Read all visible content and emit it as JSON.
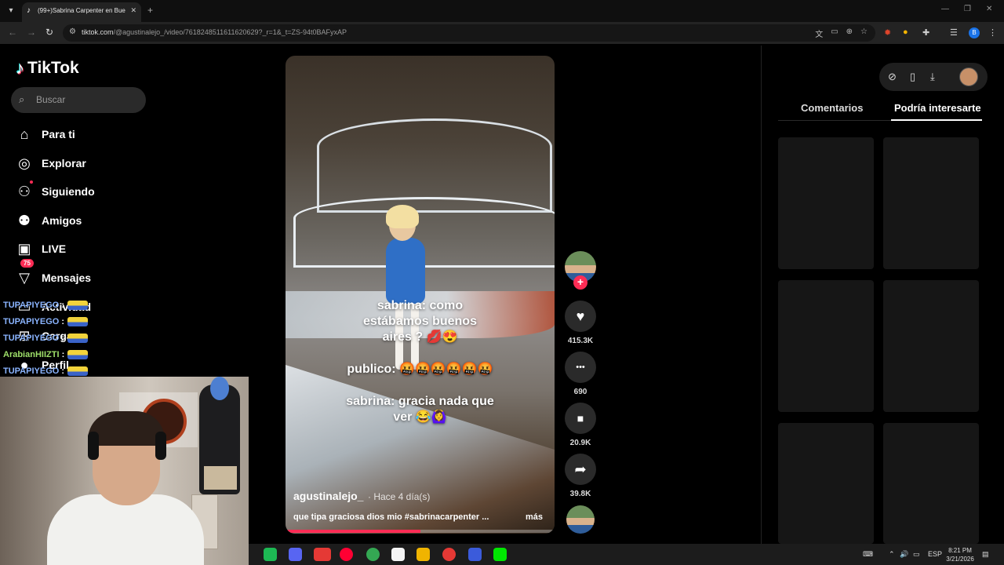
{
  "browser": {
    "tab_title": "(99+)Sabrina Carpenter en Bue...",
    "tab_favicon": "♪",
    "tab_close": "✕",
    "new_tab": "+",
    "url_host": "tiktok.com",
    "url_path": "/@agustinalejo_/video/7618248511611620629?_r=1&_t=ZS-94t0BAFyxAP",
    "back_icon": "←",
    "forward_icon": "→",
    "reload_icon": "↻",
    "profile_initial": "B"
  },
  "tiktok": {
    "logo_text": "TikTok",
    "logo_icon": "♪",
    "search_placeholder": "Buscar",
    "nav": [
      {
        "label": "Para ti",
        "icon": "⌂"
      },
      {
        "label": "Explorar",
        "icon": "◎"
      },
      {
        "label": "Siguiendo",
        "icon": "⚇"
      },
      {
        "label": "Amigos",
        "icon": "⚉"
      },
      {
        "label": "LIVE",
        "icon": "▣"
      },
      {
        "label": "Mensajes",
        "icon": "▽",
        "badge": "75"
      },
      {
        "label": "Actividad",
        "icon": "▭"
      },
      {
        "label": "Cargar",
        "icon": "⊞"
      },
      {
        "label": "Perfil",
        "icon": "●"
      }
    ]
  },
  "chat": [
    {
      "user": "TUPAPIYEGO",
      "sep": ":"
    },
    {
      "user": "TUPAPIYEGO",
      "sep": ":"
    },
    {
      "user": "TUPAPIYEGO",
      "sep": ":"
    },
    {
      "user": "ArabianHIIZTI",
      "sep": ":"
    },
    {
      "user": "TUPAPIYEGO",
      "sep": ":"
    }
  ],
  "video": {
    "caption1": "sabrina: como\nestábamos buenos\naires ? 💋😍",
    "caption2": "publico: 🤬🤬🤬🤬🤬🤬",
    "caption3": "sabrina: gracia nada que\nver 😂🙆‍♀️",
    "author": "agustinalejo_",
    "time": "· Hace 4 día(s)",
    "description": "que tipa graciosa dios mio #sabrinacarpenter ...",
    "more": "más",
    "progress": 0.5
  },
  "actions": {
    "follow": "+",
    "like_icon": "♥",
    "likes": "415.3K",
    "comment_icon": "•••",
    "comments": "690",
    "save_icon": "■",
    "saves": "20.9K",
    "share_icon": "➦",
    "shares": "39.8K"
  },
  "right_panel": {
    "tab_comments": "Comentarios",
    "tab_related": "Podría interesarte",
    "icons": [
      "⊘",
      "▯",
      "⤓"
    ]
  },
  "taskbar": {
    "lang": "ESP",
    "time": "8:21 PM",
    "date": "3/21/2026",
    "app_colors": [
      "#1db954",
      "#5865f2",
      "#e53935",
      "#ff0033",
      "#34a853",
      "#f4f4f4",
      "#f0b400",
      "#e53935",
      "#3b5bdb",
      "#00e701"
    ]
  }
}
